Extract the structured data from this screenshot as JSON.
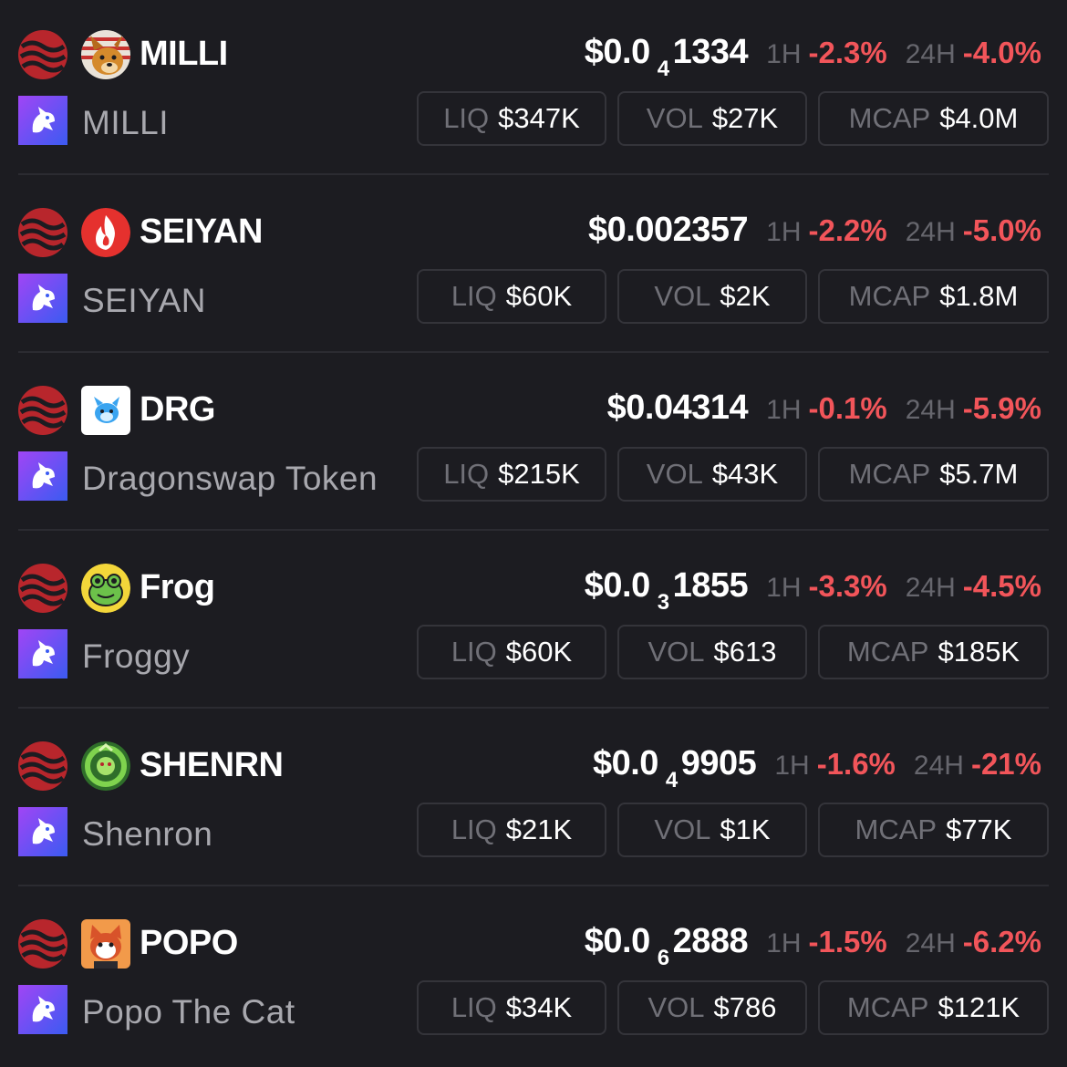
{
  "colors": {
    "background": "#1c1c21",
    "negative": "#f2555a",
    "muted": "#707077",
    "chain_red": "#b8262c",
    "dex_purple": "#6b4ff0"
  },
  "icons": {
    "chain": "sei-chain-icon",
    "dex": "dragonswap-icon"
  },
  "tokens": [
    {
      "symbol": "MILLI",
      "name": "MILLI",
      "icon": "milli-dog-icon",
      "price_main": "$0.0",
      "price_zeros": "4",
      "price_sig": "1334",
      "h1_label": "1H",
      "h1_change": "-2.3%",
      "h24_label": "24H",
      "h24_change": "-4.0%",
      "liq_label": "LIQ",
      "liq": "$347K",
      "vol_label": "VOL",
      "vol": "$27K",
      "mcap_label": "MCAP",
      "mcap": "$4.0M"
    },
    {
      "symbol": "SEIYAN",
      "name": "SEIYAN",
      "icon": "flame-icon",
      "price_main": "$0.002357",
      "price_zeros": "",
      "price_sig": "",
      "h1_label": "1H",
      "h1_change": "-2.2%",
      "h24_label": "24H",
      "h24_change": "-5.0%",
      "liq_label": "LIQ",
      "liq": "$60K",
      "vol_label": "VOL",
      "vol": "$2K",
      "mcap_label": "MCAP",
      "mcap": "$1.8M"
    },
    {
      "symbol": "DRG",
      "name": "Dragonswap Token",
      "icon": "dragon-logo-icon",
      "price_main": "$0.04314",
      "price_zeros": "",
      "price_sig": "",
      "h1_label": "1H",
      "h1_change": "-0.1%",
      "h24_label": "24H",
      "h24_change": "-5.9%",
      "liq_label": "LIQ",
      "liq": "$215K",
      "vol_label": "VOL",
      "vol": "$43K",
      "mcap_label": "MCAP",
      "mcap": "$5.7M"
    },
    {
      "symbol": "Frog",
      "name": "Froggy",
      "icon": "frog-icon",
      "price_main": "$0.0",
      "price_zeros": "3",
      "price_sig": "1855",
      "h1_label": "1H",
      "h1_change": "-3.3%",
      "h24_label": "24H",
      "h24_change": "-4.5%",
      "liq_label": "LIQ",
      "liq": "$60K",
      "vol_label": "VOL",
      "vol": "$613",
      "mcap_label": "MCAP",
      "mcap": "$185K"
    },
    {
      "symbol": "SHENRN",
      "name": "Shenron",
      "icon": "green-dragon-icon",
      "price_main": "$0.0",
      "price_zeros": "4",
      "price_sig": "9905",
      "h1_label": "1H",
      "h1_change": "-1.6%",
      "h24_label": "24H",
      "h24_change": "-21%",
      "liq_label": "LIQ",
      "liq": "$21K",
      "vol_label": "VOL",
      "vol": "$1K",
      "mcap_label": "MCAP",
      "mcap": "$77K"
    },
    {
      "symbol": "POPO",
      "name": "Popo The Cat",
      "icon": "cat-icon",
      "price_main": "$0.0",
      "price_zeros": "6",
      "price_sig": "2888",
      "h1_label": "1H",
      "h1_change": "-1.5%",
      "h24_label": "24H",
      "h24_change": "-6.2%",
      "liq_label": "LIQ",
      "liq": "$34K",
      "vol_label": "VOL",
      "vol": "$786",
      "mcap_label": "MCAP",
      "mcap": "$121K"
    }
  ]
}
